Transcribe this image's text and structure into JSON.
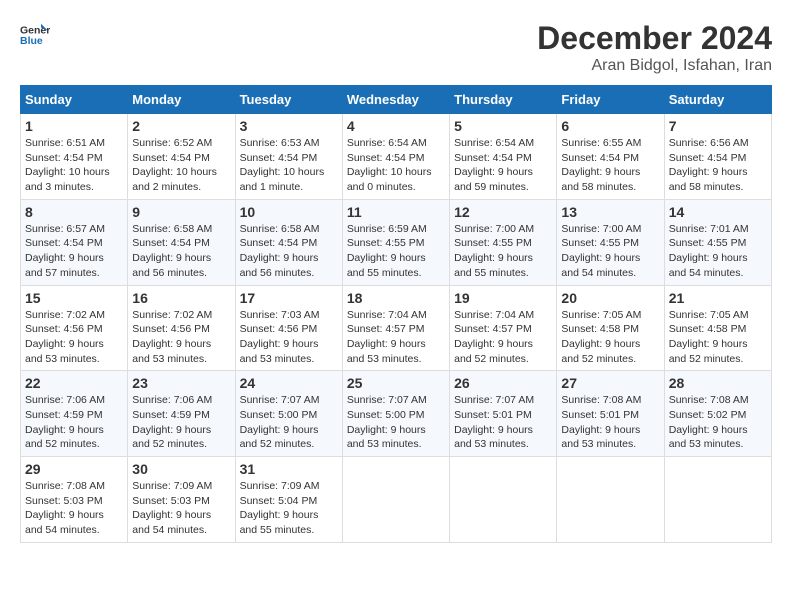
{
  "header": {
    "logo_general": "General",
    "logo_blue": "Blue",
    "main_title": "December 2024",
    "subtitle": "Aran Bidgol, Isfahan, Iran"
  },
  "calendar": {
    "days_of_week": [
      "Sunday",
      "Monday",
      "Tuesday",
      "Wednesday",
      "Thursday",
      "Friday",
      "Saturday"
    ],
    "weeks": [
      [
        null,
        null,
        null,
        null,
        null,
        null,
        null
      ]
    ],
    "cells": [
      {
        "day": 1,
        "col": 0,
        "sunrise": "6:51 AM",
        "sunset": "4:54 PM",
        "daylight": "10 hours and 3 minutes."
      },
      {
        "day": 2,
        "col": 1,
        "sunrise": "6:52 AM",
        "sunset": "4:54 PM",
        "daylight": "10 hours and 2 minutes."
      },
      {
        "day": 3,
        "col": 2,
        "sunrise": "6:53 AM",
        "sunset": "4:54 PM",
        "daylight": "10 hours and 1 minute."
      },
      {
        "day": 4,
        "col": 3,
        "sunrise": "6:54 AM",
        "sunset": "4:54 PM",
        "daylight": "10 hours and 0 minutes."
      },
      {
        "day": 5,
        "col": 4,
        "sunrise": "6:54 AM",
        "sunset": "4:54 PM",
        "daylight": "9 hours and 59 minutes."
      },
      {
        "day": 6,
        "col": 5,
        "sunrise": "6:55 AM",
        "sunset": "4:54 PM",
        "daylight": "9 hours and 58 minutes."
      },
      {
        "day": 7,
        "col": 6,
        "sunrise": "6:56 AM",
        "sunset": "4:54 PM",
        "daylight": "9 hours and 58 minutes."
      },
      {
        "day": 8,
        "col": 0,
        "sunrise": "6:57 AM",
        "sunset": "4:54 PM",
        "daylight": "9 hours and 57 minutes."
      },
      {
        "day": 9,
        "col": 1,
        "sunrise": "6:58 AM",
        "sunset": "4:54 PM",
        "daylight": "9 hours and 56 minutes."
      },
      {
        "day": 10,
        "col": 2,
        "sunrise": "6:58 AM",
        "sunset": "4:54 PM",
        "daylight": "9 hours and 56 minutes."
      },
      {
        "day": 11,
        "col": 3,
        "sunrise": "6:59 AM",
        "sunset": "4:55 PM",
        "daylight": "9 hours and 55 minutes."
      },
      {
        "day": 12,
        "col": 4,
        "sunrise": "7:00 AM",
        "sunset": "4:55 PM",
        "daylight": "9 hours and 55 minutes."
      },
      {
        "day": 13,
        "col": 5,
        "sunrise": "7:00 AM",
        "sunset": "4:55 PM",
        "daylight": "9 hours and 54 minutes."
      },
      {
        "day": 14,
        "col": 6,
        "sunrise": "7:01 AM",
        "sunset": "4:55 PM",
        "daylight": "9 hours and 54 minutes."
      },
      {
        "day": 15,
        "col": 0,
        "sunrise": "7:02 AM",
        "sunset": "4:56 PM",
        "daylight": "9 hours and 53 minutes."
      },
      {
        "day": 16,
        "col": 1,
        "sunrise": "7:02 AM",
        "sunset": "4:56 PM",
        "daylight": "9 hours and 53 minutes."
      },
      {
        "day": 17,
        "col": 2,
        "sunrise": "7:03 AM",
        "sunset": "4:56 PM",
        "daylight": "9 hours and 53 minutes."
      },
      {
        "day": 18,
        "col": 3,
        "sunrise": "7:04 AM",
        "sunset": "4:57 PM",
        "daylight": "9 hours and 53 minutes."
      },
      {
        "day": 19,
        "col": 4,
        "sunrise": "7:04 AM",
        "sunset": "4:57 PM",
        "daylight": "9 hours and 52 minutes."
      },
      {
        "day": 20,
        "col": 5,
        "sunrise": "7:05 AM",
        "sunset": "4:58 PM",
        "daylight": "9 hours and 52 minutes."
      },
      {
        "day": 21,
        "col": 6,
        "sunrise": "7:05 AM",
        "sunset": "4:58 PM",
        "daylight": "9 hours and 52 minutes."
      },
      {
        "day": 22,
        "col": 0,
        "sunrise": "7:06 AM",
        "sunset": "4:59 PM",
        "daylight": "9 hours and 52 minutes."
      },
      {
        "day": 23,
        "col": 1,
        "sunrise": "7:06 AM",
        "sunset": "4:59 PM",
        "daylight": "9 hours and 52 minutes."
      },
      {
        "day": 24,
        "col": 2,
        "sunrise": "7:07 AM",
        "sunset": "5:00 PM",
        "daylight": "9 hours and 52 minutes."
      },
      {
        "day": 25,
        "col": 3,
        "sunrise": "7:07 AM",
        "sunset": "5:00 PM",
        "daylight": "9 hours and 53 minutes."
      },
      {
        "day": 26,
        "col": 4,
        "sunrise": "7:07 AM",
        "sunset": "5:01 PM",
        "daylight": "9 hours and 53 minutes."
      },
      {
        "day": 27,
        "col": 5,
        "sunrise": "7:08 AM",
        "sunset": "5:01 PM",
        "daylight": "9 hours and 53 minutes."
      },
      {
        "day": 28,
        "col": 6,
        "sunrise": "7:08 AM",
        "sunset": "5:02 PM",
        "daylight": "9 hours and 53 minutes."
      },
      {
        "day": 29,
        "col": 0,
        "sunrise": "7:08 AM",
        "sunset": "5:03 PM",
        "daylight": "9 hours and 54 minutes."
      },
      {
        "day": 30,
        "col": 1,
        "sunrise": "7:09 AM",
        "sunset": "5:03 PM",
        "daylight": "9 hours and 54 minutes."
      },
      {
        "day": 31,
        "col": 2,
        "sunrise": "7:09 AM",
        "sunset": "5:04 PM",
        "daylight": "9 hours and 55 minutes."
      }
    ]
  }
}
